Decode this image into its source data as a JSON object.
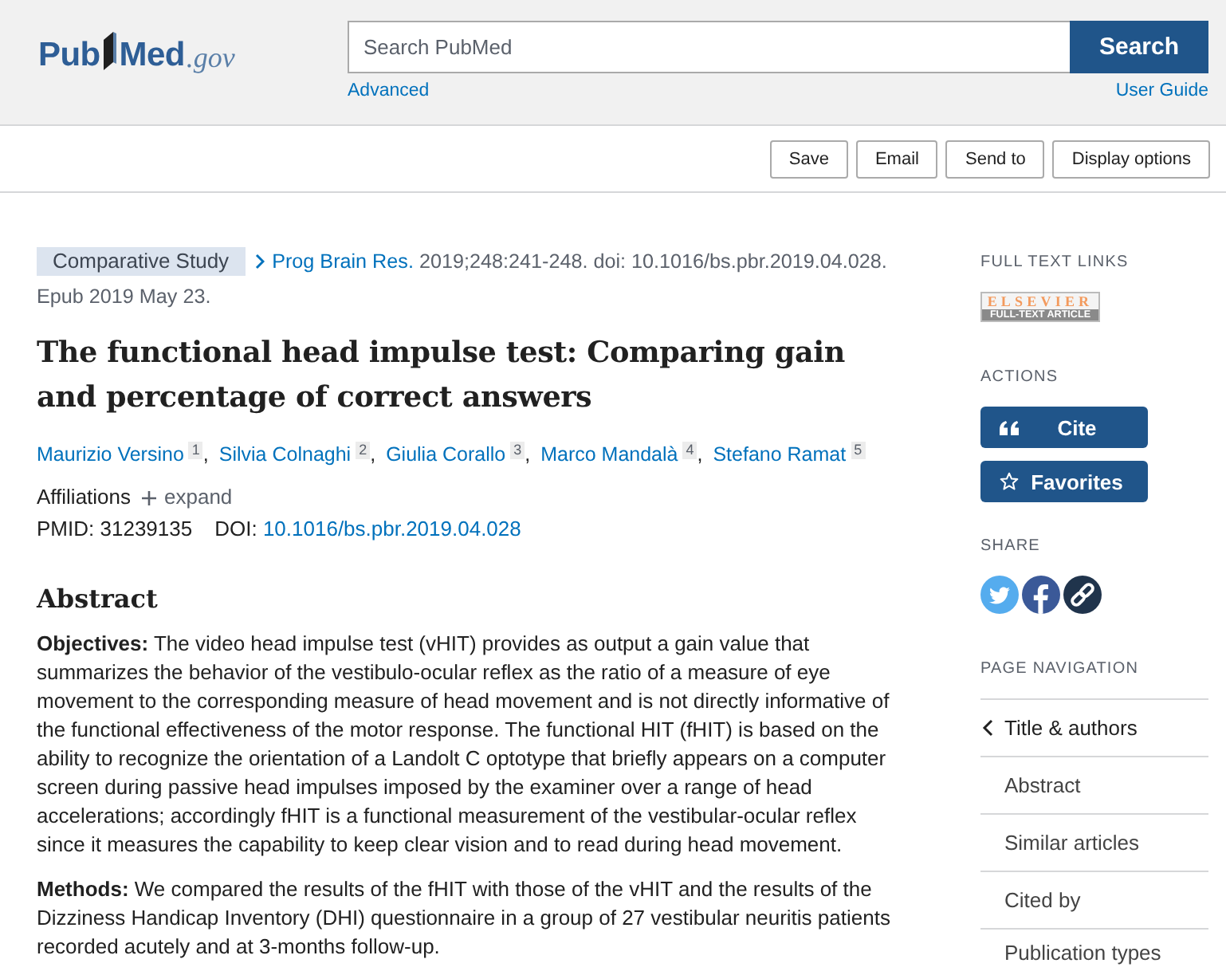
{
  "header": {
    "logo": {
      "left": "Pub",
      "right": "Med",
      "domain": ".gov"
    },
    "search": {
      "placeholder": "Search PubMed",
      "button": "Search"
    },
    "links": [
      {
        "label": "Advanced"
      },
      {
        "label": "User Guide"
      }
    ]
  },
  "toolbar": {
    "buttons": [
      "Save",
      "Email",
      "Send to",
      "Display options"
    ]
  },
  "article": {
    "type_badge": "Comparative Study",
    "journal": "Prog Brain Res.",
    "citation": "2019;248:241-248. doi: 10.1016/bs.pbr.2019.04.028.",
    "epub": "Epub 2019 May 23.",
    "title": "The functional head impulse test: Comparing gain and percentage of correct answers",
    "authors": [
      {
        "name": "Maurizio Versino",
        "ref": "1",
        "separator": ","
      },
      {
        "name": "Silvia Colnaghi",
        "ref": "2",
        "separator": ","
      },
      {
        "name": "Giulia Corallo",
        "ref": "3",
        "separator": ","
      },
      {
        "name": "Marco Mandalà",
        "ref": "4",
        "separator": ","
      },
      {
        "name": "Stefano Ramat",
        "ref": "5"
      }
    ],
    "affiliations": {
      "label": "Affiliations",
      "toggle": "expand",
      "expanded": false
    },
    "identifiers": [
      {
        "label": "PMID:",
        "value": "31239135",
        "kind": "text"
      },
      {
        "label": "DOI:",
        "value": "10.1016/bs.pbr.2019.04.028",
        "kind": "link"
      }
    ]
  },
  "abstract": {
    "heading": "Abstract",
    "paragraphs": [
      "**Objectives:** The video head impulse test (vHIT) provides as output a gain value that summarizes the behavior of the vestibulo-ocular reflex as the ratio of a measure of eye movement to the corresponding measure of head movement and is not directly informative of the functional effectiveness of the motor response. The functional HIT (fHIT) is based on the ability to recognize the orientation of a Landolt C optotype that briefly appears on a computer screen during passive head impulses imposed by the examiner over a range of head accelerations; accordingly fHIT is a functional measurement of the vestibular-ocular reflex since it measures the capability to keep clear vision and to read during head movement.",
      "**Methods:** We compared the results of the fHIT with those of the vHIT and the results of the Dizziness Handicap Inventory (DHI) questionnaire in a group of 27 vestibular neuritis patients recorded acutely and at 3-months follow-up."
    ]
  },
  "sidebar": {
    "full_text_links": {
      "heading": "FULL TEXT LINKS",
      "providers": [
        {
          "publisher": "ELSEVIER",
          "label": "FULL-TEXT ARTICLE"
        }
      ]
    },
    "actions": {
      "heading": "ACTIONS",
      "buttons": [
        {
          "label": "Cite",
          "kind": "cite"
        },
        {
          "label": "Favorites",
          "kind": "favorite"
        }
      ]
    },
    "share": {
      "heading": "SHARE",
      "links": [
        {
          "kind": "twitter"
        },
        {
          "kind": "facebook"
        },
        {
          "kind": "permalink"
        }
      ]
    },
    "page_navigation": {
      "heading": "PAGE NAVIGATION",
      "items": [
        {
          "label": "Title & authors",
          "selected": true
        },
        {
          "label": "Abstract",
          "selected": false
        },
        {
          "label": "Similar articles",
          "selected": false
        },
        {
          "label": "Cited by",
          "selected": false
        },
        {
          "label": "Publication types",
          "selected": false
        }
      ]
    }
  }
}
